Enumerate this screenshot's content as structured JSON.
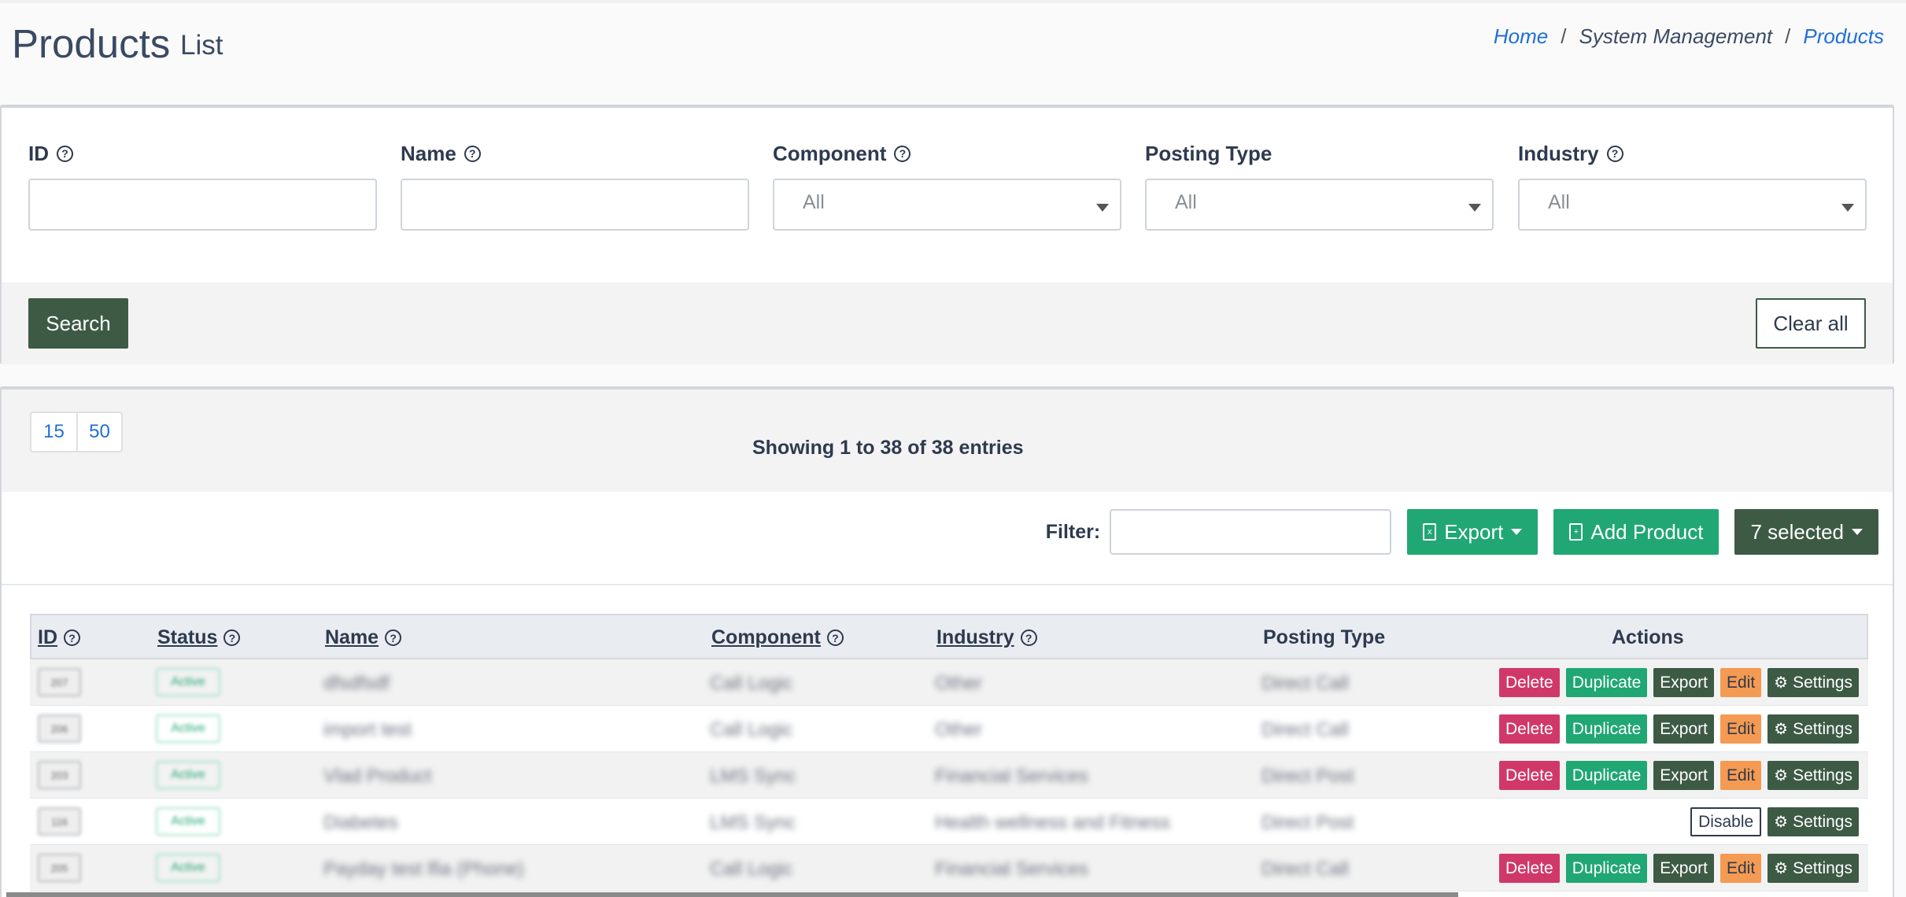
{
  "header": {
    "title": "Products",
    "subtitle": "List",
    "breadcrumb": [
      "Home",
      "System Management",
      "Products"
    ]
  },
  "filters": {
    "id_label": "ID",
    "name_label": "Name",
    "component_label": "Component",
    "component_value": "All",
    "posting_type_label": "Posting Type",
    "posting_type_value": "All",
    "industry_label": "Industry",
    "industry_value": "All",
    "search_label": "Search",
    "clear_label": "Clear all",
    "help_glyph": "?"
  },
  "table_controls": {
    "page_sizes": [
      "15",
      "50"
    ],
    "showing": "Showing 1 to 38 of 38 entries",
    "filter_label": "Filter:",
    "export_label": "Export",
    "add_label": "Add Product",
    "selected_label": "7 selected"
  },
  "table": {
    "headers": {
      "id": "ID",
      "status": "Status",
      "name": "Name",
      "component": "Component",
      "industry": "Industry",
      "posting_type": "Posting Type",
      "actions": "Actions"
    },
    "rows": [
      {
        "id": "207",
        "status": "Active",
        "name": "dfsdfsdf",
        "component": "Call Logic",
        "industry": "Other",
        "posting_type": "Direct Call",
        "actions": [
          "Delete",
          "Duplicate",
          "Export",
          "Edit",
          "Settings"
        ]
      },
      {
        "id": "206",
        "status": "Active",
        "name": "import test",
        "component": "Call Logic",
        "industry": "Other",
        "posting_type": "Direct Call",
        "actions": [
          "Delete",
          "Duplicate",
          "Export",
          "Edit",
          "Settings"
        ]
      },
      {
        "id": "203",
        "status": "Active",
        "name": "Vlad Product",
        "component": "LMS Sync",
        "industry": "Financial Services",
        "posting_type": "Direct Post",
        "actions": [
          "Delete",
          "Duplicate",
          "Export",
          "Edit",
          "Settings"
        ]
      },
      {
        "id": "116",
        "status": "Active",
        "name": "Diabetes",
        "component": "LMS Sync",
        "industry": "Health wellness and Fitness",
        "posting_type": "Direct Post",
        "actions": [
          "Disable",
          "Settings"
        ]
      },
      {
        "id": "205",
        "status": "Active",
        "name": "Payday test lfia (Phone)",
        "component": "Call Logic",
        "industry": "Financial Services",
        "posting_type": "Direct Call",
        "actions": [
          "Delete",
          "Duplicate",
          "Export",
          "Edit",
          "Settings"
        ]
      }
    ]
  },
  "colors": {
    "primary_dark": "#3d5a45",
    "green": "#20a774",
    "danger": "#d1386a",
    "warning": "#f59a52",
    "link": "#1f6fd6"
  },
  "icons": {
    "help": "help-circle-icon",
    "export": "file-excel-icon",
    "add": "file-plus-icon",
    "settings": "gears-icon",
    "dropdown": "caret-down-icon"
  }
}
